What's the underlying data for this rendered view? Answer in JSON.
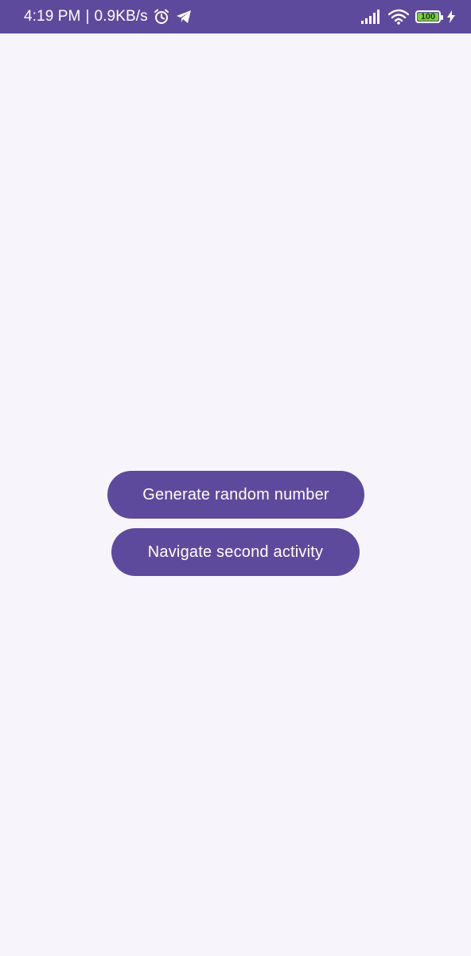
{
  "status_bar": {
    "time": "4:19 PM",
    "separator": "|",
    "network_speed": "0.9KB/s",
    "battery_level": "100",
    "battery_fraction": 1.0,
    "icons": [
      "alarm-icon",
      "telegram-icon",
      "signal-icon",
      "wifi-icon",
      "battery-icon",
      "charging-icon"
    ],
    "background_color": "#5e4a9c",
    "battery_color": "#7ad23c"
  },
  "main": {
    "generate_button_label": "Generate random number",
    "navigate_button_label": "Navigate second activity",
    "button_color": "#5e4a9c",
    "background_color": "#f7f5fb"
  }
}
